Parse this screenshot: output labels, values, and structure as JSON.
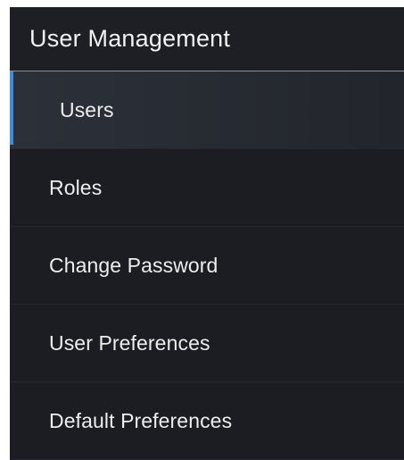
{
  "panel": {
    "title": "User Management",
    "accent_color": "#3b8ee8",
    "background_color": "#1b1d22"
  },
  "nav": {
    "items": [
      {
        "label": "Users",
        "active": true
      },
      {
        "label": "Roles",
        "active": false
      },
      {
        "label": "Change Password",
        "active": false
      },
      {
        "label": "User Preferences",
        "active": false
      },
      {
        "label": "Default Preferences",
        "active": false
      }
    ]
  }
}
